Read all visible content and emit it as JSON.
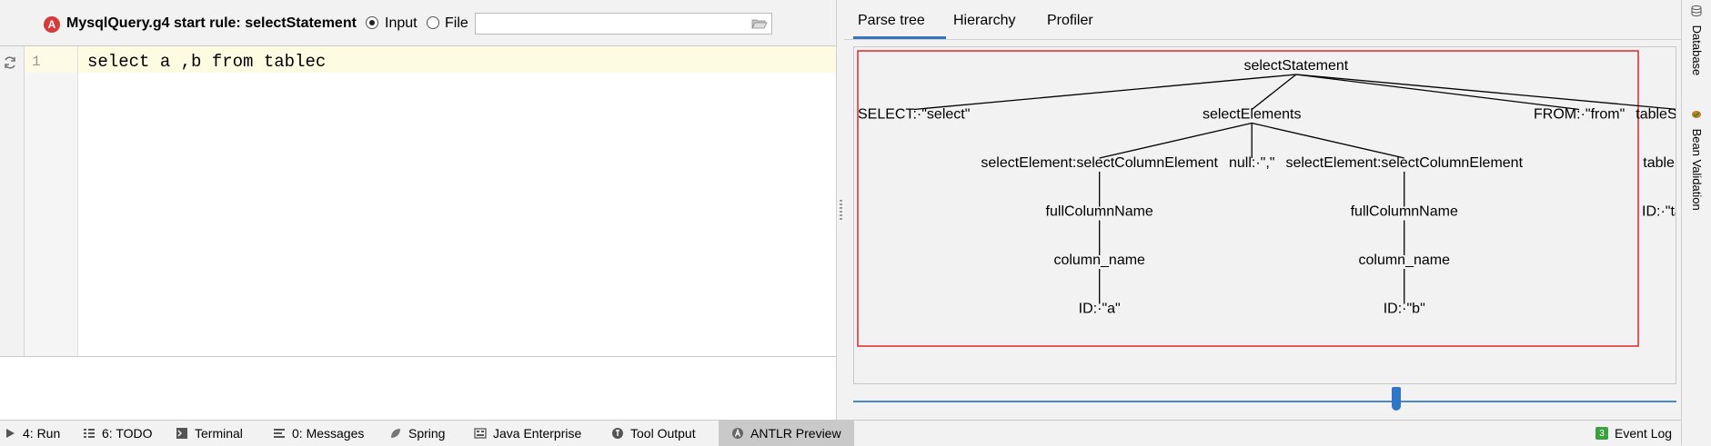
{
  "editor_header": {
    "start_rule_label": "MysqlQuery.g4 start rule: selectStatement",
    "input_option": "Input",
    "file_option": "File",
    "selected_option": "Input",
    "file_path_value": ""
  },
  "editor": {
    "line_number": "1",
    "code": "select a ,b from tablec"
  },
  "tabs": [
    {
      "label": "Parse tree",
      "active": true
    },
    {
      "label": "Hierarchy",
      "active": false
    },
    {
      "label": "Profiler",
      "active": false
    }
  ],
  "parse_tree": {
    "highlight_color": "#e0262b",
    "root": {
      "label": "selectStatement",
      "children": [
        {
          "label": "SELECT:·\"select\"",
          "children": []
        },
        {
          "label": "selectElements",
          "children": [
            {
              "label": "selectElement:selectColumnElement",
              "children": [
                {
                  "label": "fullColumnName",
                  "children": [
                    {
                      "label": "column_name",
                      "children": [
                        {
                          "label": "ID:·\"a\"",
                          "children": []
                        }
                      ]
                    }
                  ]
                }
              ]
            },
            {
              "label": "null:·\",\"",
              "children": []
            },
            {
              "label": "selectElement:selectColumnElement",
              "children": [
                {
                  "label": "fullColumnName",
                  "children": [
                    {
                      "label": "column_name",
                      "children": [
                        {
                          "label": "ID:·\"b\"",
                          "children": []
                        }
                      ]
                    }
                  ]
                }
              ]
            }
          ]
        },
        {
          "label": "FROM:·\"from\"",
          "children": []
        },
        {
          "label": "tableSources",
          "children": [
            {
              "label": "tableName",
              "children": [
                {
                  "label": "ID:·\"tablec\"",
                  "children": []
                }
              ]
            }
          ]
        }
      ]
    }
  },
  "zoom_slider": {
    "value": 0.66
  },
  "right_sidebar": [
    {
      "label": "Database",
      "icon": "database-icon"
    },
    {
      "label": "Bean Validation",
      "icon": "bean-validation-icon"
    }
  ],
  "status_bar": {
    "items": [
      {
        "label": "4: Run",
        "icon": "run-icon",
        "active": false
      },
      {
        "label": "6: TODO",
        "icon": "todo-icon",
        "active": false
      },
      {
        "label": "Terminal",
        "icon": "terminal-icon",
        "active": false
      },
      {
        "label": "0: Messages",
        "icon": "messages-icon",
        "active": false
      },
      {
        "label": "Spring",
        "icon": "spring-icon",
        "active": false
      },
      {
        "label": "Java Enterprise",
        "icon": "java-enterprise-icon",
        "active": false
      },
      {
        "label": "Tool Output",
        "icon": "tool-output-icon",
        "active": false
      },
      {
        "label": "ANTLR Preview",
        "icon": "antlr-icon",
        "active": true
      }
    ],
    "event_log": "Event Log",
    "event_badge": "3"
  }
}
